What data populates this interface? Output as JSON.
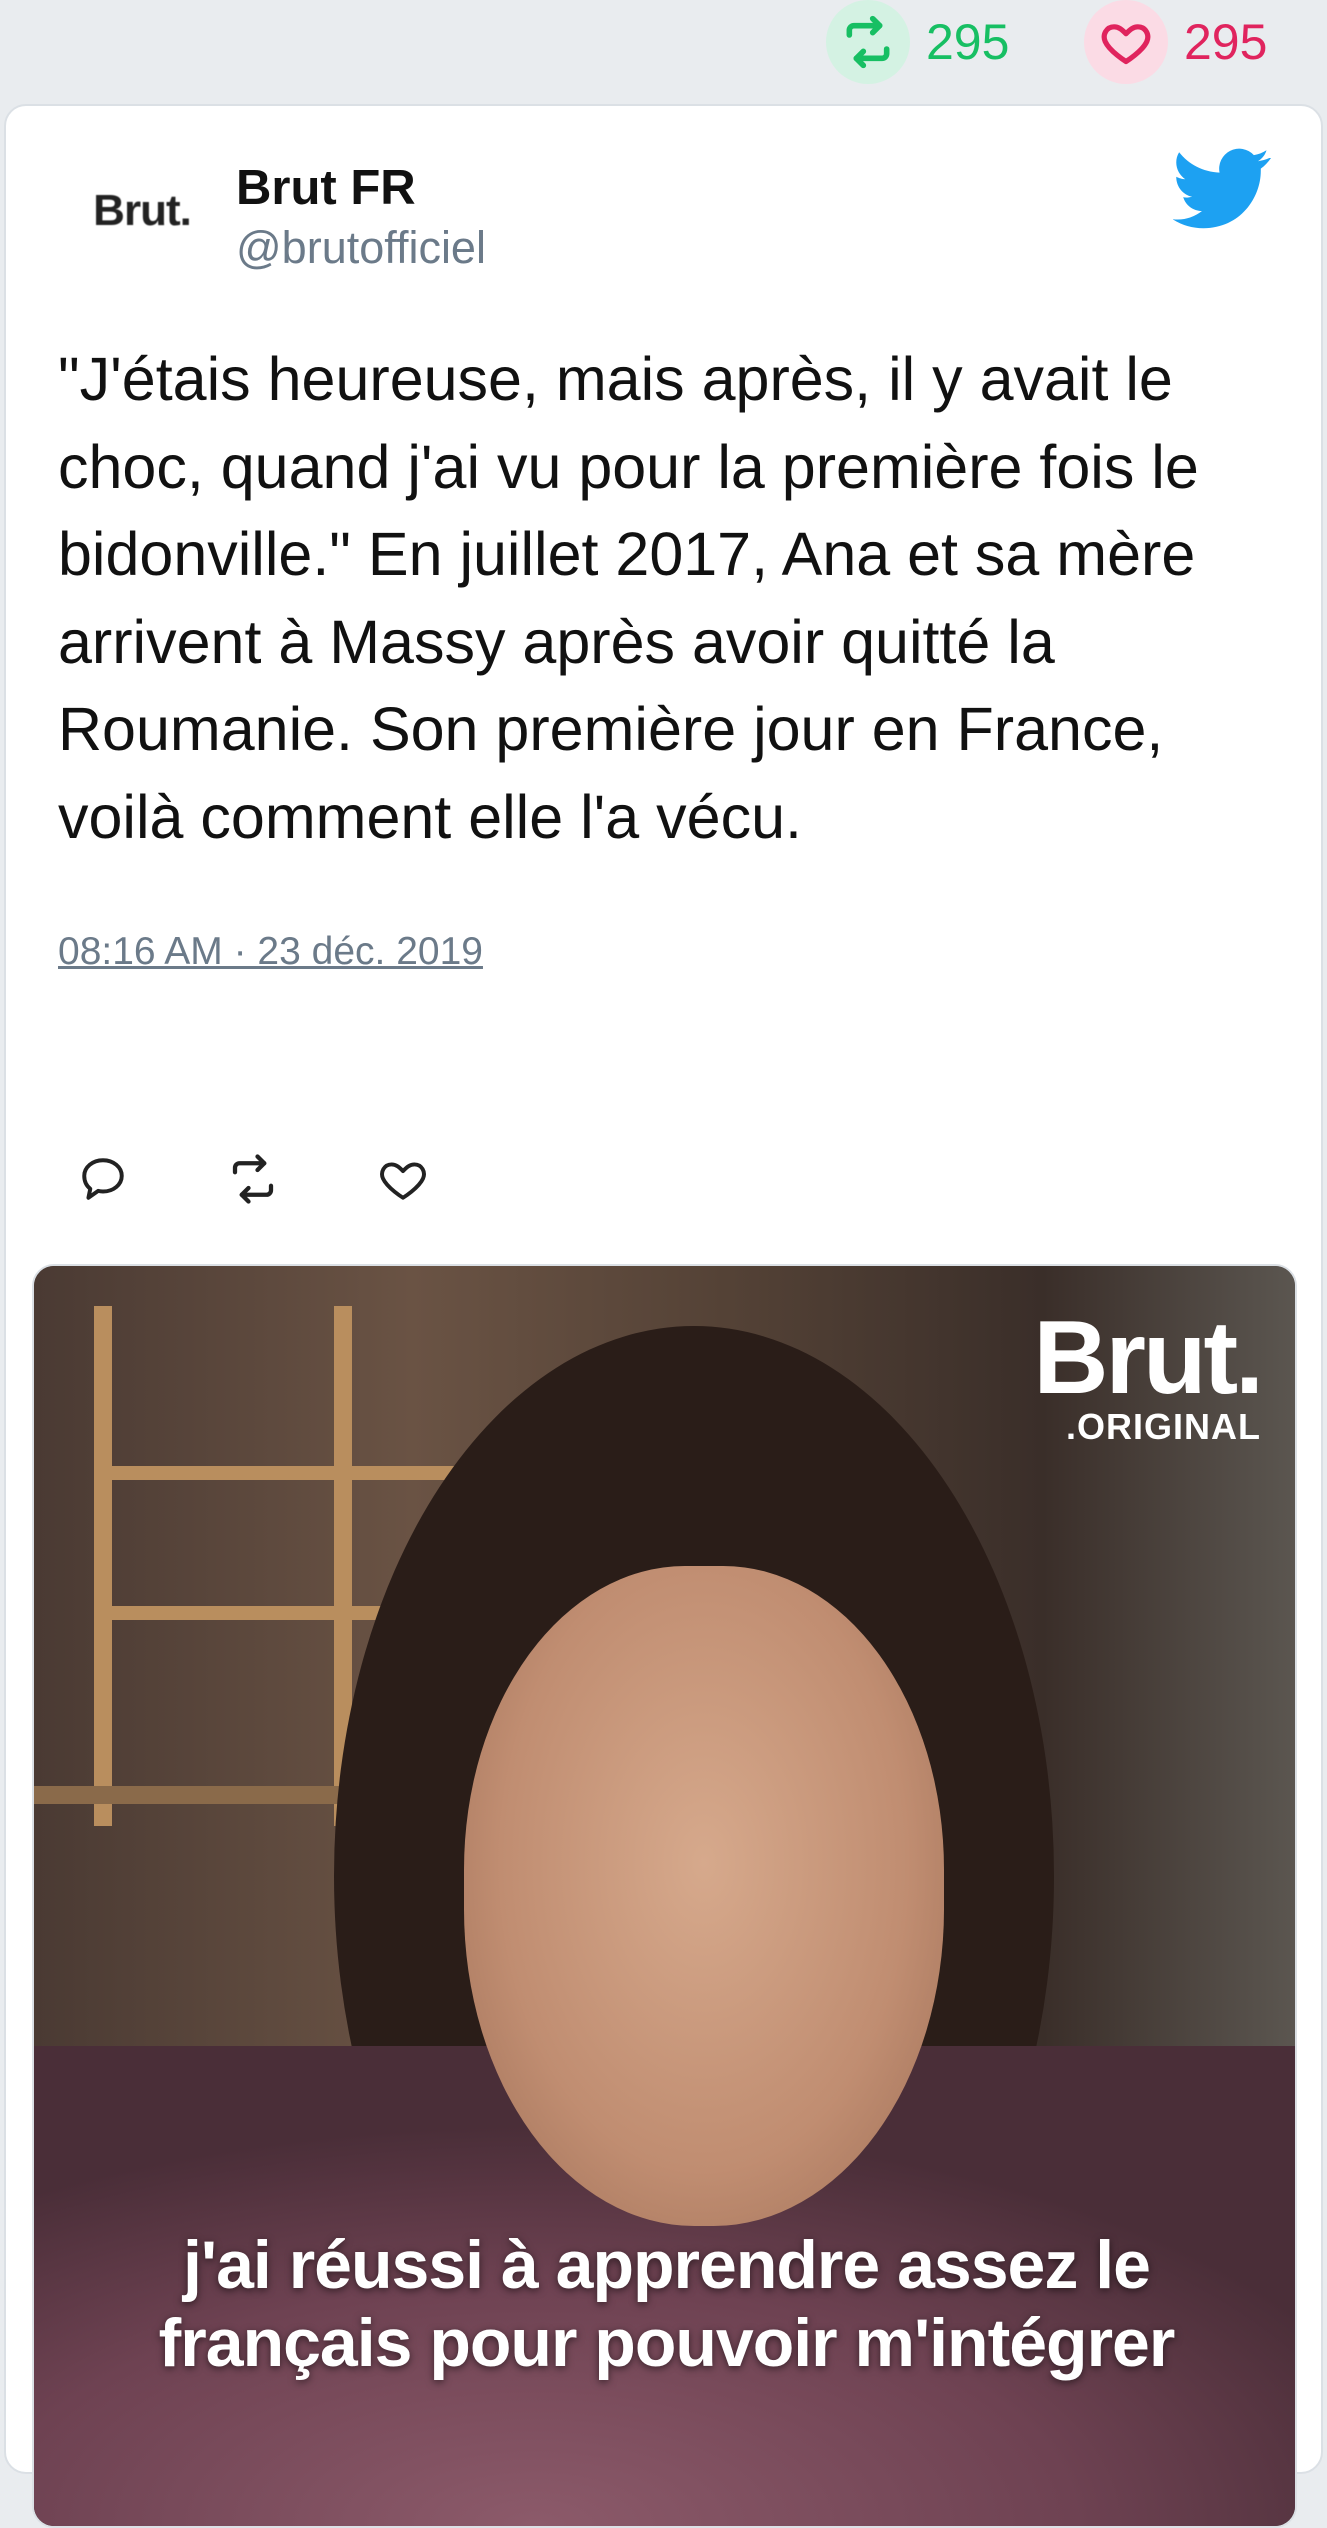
{
  "stats": {
    "retweet_count": "295",
    "like_count": "295"
  },
  "tweet": {
    "author_name": "Brut FR",
    "author_handle": "@brutofficiel",
    "avatar_text": "Brut.",
    "text": "\"J'étais heureuse, mais après, il y avait le choc, quand j'ai vu pour la première fois le bidonville.\" En juillet 2017, Ana et sa mère arrivent à Massy après avoir quitté la Roumanie. Son première jour en France, voilà comment elle l'a vécu.",
    "timestamp": "08:16 AM · 23 déc. 2019"
  },
  "actions": {
    "icons": [
      "reply-icon",
      "retweet-icon",
      "like-icon"
    ]
  },
  "media": {
    "logo_main": "Brut.",
    "logo_sub": ".ORIGINAL",
    "subtitle_line1": "j'ai réussi à apprendre assez le",
    "subtitle_line2": "français pour pouvoir m'intégrer"
  },
  "colors": {
    "retweet": "#17bf63",
    "like": "#e0245e",
    "twitter_blue": "#1da1f2",
    "muted": "#6b7a89"
  }
}
